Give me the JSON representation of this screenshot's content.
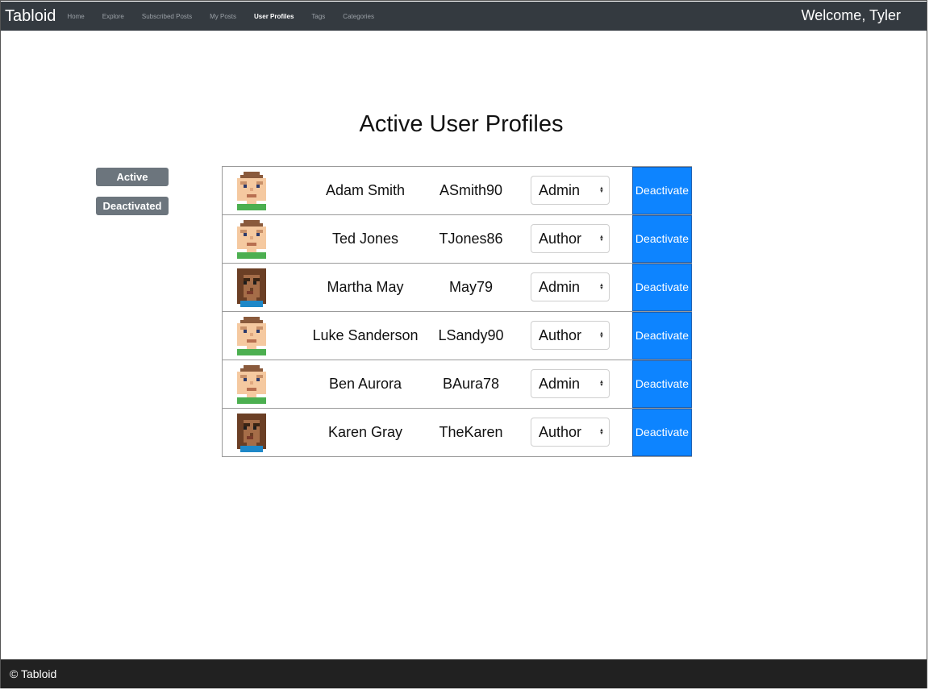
{
  "nav": {
    "brand": "Tabloid",
    "links": [
      "Home",
      "Explore",
      "Subscribed Posts",
      "My Posts",
      "User Profiles",
      "Tags",
      "Categories"
    ],
    "active_link": "User Profiles",
    "welcome": "Welcome, Tyler"
  },
  "page": {
    "title": "Active User Profiles"
  },
  "filters": {
    "active_label": "Active",
    "deactivated_label": "Deactivated"
  },
  "users": [
    {
      "avatar": "male-avatar-icon",
      "name": "Adam Smith",
      "username": "ASmith90",
      "role": "Admin",
      "action": "Deactivate"
    },
    {
      "avatar": "male-avatar-icon",
      "name": "Ted Jones",
      "username": "TJones86",
      "role": "Author",
      "action": "Deactivate"
    },
    {
      "avatar": "female-avatar-icon",
      "name": "Martha May",
      "username": "May79",
      "role": "Admin",
      "action": "Deactivate"
    },
    {
      "avatar": "male-avatar-icon",
      "name": "Luke Sanderson",
      "username": "LSandy90",
      "role": "Author",
      "action": "Deactivate"
    },
    {
      "avatar": "male-avatar-icon",
      "name": "Ben Aurora",
      "username": "BAura78",
      "role": "Admin",
      "action": "Deactivate"
    },
    {
      "avatar": "female-avatar-icon",
      "name": "Karen Gray",
      "username": "TheKaren",
      "role": "Author",
      "action": "Deactivate"
    }
  ],
  "footer": {
    "text": "© Tabloid"
  },
  "colors": {
    "navbar": "#343a40",
    "primary": "#0d84ff",
    "secondary": "#6c757d",
    "footer": "#212121"
  }
}
